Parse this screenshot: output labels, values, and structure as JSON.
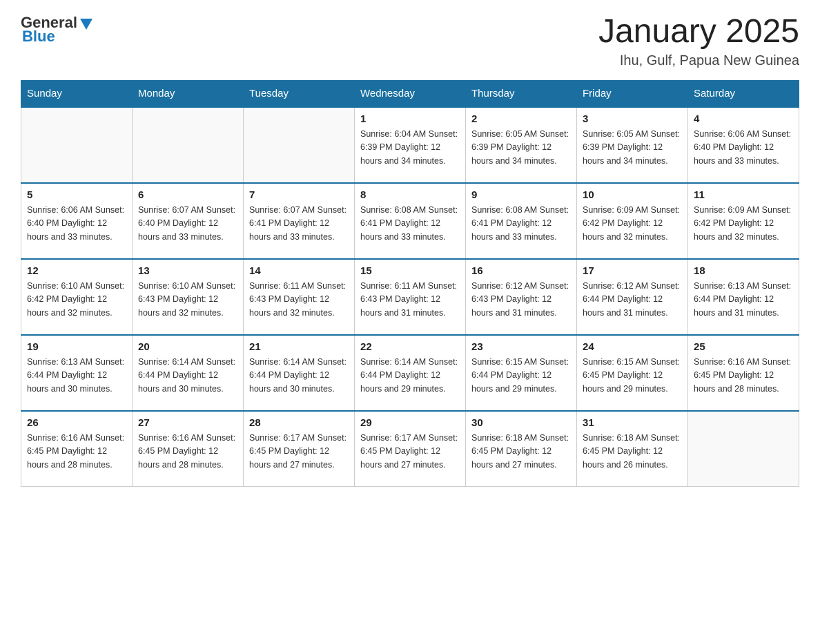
{
  "header": {
    "logo_general": "General",
    "logo_blue": "Blue",
    "month_title": "January 2025",
    "location": "Ihu, Gulf, Papua New Guinea"
  },
  "days_of_week": [
    "Sunday",
    "Monday",
    "Tuesday",
    "Wednesday",
    "Thursday",
    "Friday",
    "Saturday"
  ],
  "weeks": [
    [
      {
        "day": "",
        "info": ""
      },
      {
        "day": "",
        "info": ""
      },
      {
        "day": "",
        "info": ""
      },
      {
        "day": "1",
        "info": "Sunrise: 6:04 AM\nSunset: 6:39 PM\nDaylight: 12 hours\nand 34 minutes."
      },
      {
        "day": "2",
        "info": "Sunrise: 6:05 AM\nSunset: 6:39 PM\nDaylight: 12 hours\nand 34 minutes."
      },
      {
        "day": "3",
        "info": "Sunrise: 6:05 AM\nSunset: 6:39 PM\nDaylight: 12 hours\nand 34 minutes."
      },
      {
        "day": "4",
        "info": "Sunrise: 6:06 AM\nSunset: 6:40 PM\nDaylight: 12 hours\nand 33 minutes."
      }
    ],
    [
      {
        "day": "5",
        "info": "Sunrise: 6:06 AM\nSunset: 6:40 PM\nDaylight: 12 hours\nand 33 minutes."
      },
      {
        "day": "6",
        "info": "Sunrise: 6:07 AM\nSunset: 6:40 PM\nDaylight: 12 hours\nand 33 minutes."
      },
      {
        "day": "7",
        "info": "Sunrise: 6:07 AM\nSunset: 6:41 PM\nDaylight: 12 hours\nand 33 minutes."
      },
      {
        "day": "8",
        "info": "Sunrise: 6:08 AM\nSunset: 6:41 PM\nDaylight: 12 hours\nand 33 minutes."
      },
      {
        "day": "9",
        "info": "Sunrise: 6:08 AM\nSunset: 6:41 PM\nDaylight: 12 hours\nand 33 minutes."
      },
      {
        "day": "10",
        "info": "Sunrise: 6:09 AM\nSunset: 6:42 PM\nDaylight: 12 hours\nand 32 minutes."
      },
      {
        "day": "11",
        "info": "Sunrise: 6:09 AM\nSunset: 6:42 PM\nDaylight: 12 hours\nand 32 minutes."
      }
    ],
    [
      {
        "day": "12",
        "info": "Sunrise: 6:10 AM\nSunset: 6:42 PM\nDaylight: 12 hours\nand 32 minutes."
      },
      {
        "day": "13",
        "info": "Sunrise: 6:10 AM\nSunset: 6:43 PM\nDaylight: 12 hours\nand 32 minutes."
      },
      {
        "day": "14",
        "info": "Sunrise: 6:11 AM\nSunset: 6:43 PM\nDaylight: 12 hours\nand 32 minutes."
      },
      {
        "day": "15",
        "info": "Sunrise: 6:11 AM\nSunset: 6:43 PM\nDaylight: 12 hours\nand 31 minutes."
      },
      {
        "day": "16",
        "info": "Sunrise: 6:12 AM\nSunset: 6:43 PM\nDaylight: 12 hours\nand 31 minutes."
      },
      {
        "day": "17",
        "info": "Sunrise: 6:12 AM\nSunset: 6:44 PM\nDaylight: 12 hours\nand 31 minutes."
      },
      {
        "day": "18",
        "info": "Sunrise: 6:13 AM\nSunset: 6:44 PM\nDaylight: 12 hours\nand 31 minutes."
      }
    ],
    [
      {
        "day": "19",
        "info": "Sunrise: 6:13 AM\nSunset: 6:44 PM\nDaylight: 12 hours\nand 30 minutes."
      },
      {
        "day": "20",
        "info": "Sunrise: 6:14 AM\nSunset: 6:44 PM\nDaylight: 12 hours\nand 30 minutes."
      },
      {
        "day": "21",
        "info": "Sunrise: 6:14 AM\nSunset: 6:44 PM\nDaylight: 12 hours\nand 30 minutes."
      },
      {
        "day": "22",
        "info": "Sunrise: 6:14 AM\nSunset: 6:44 PM\nDaylight: 12 hours\nand 29 minutes."
      },
      {
        "day": "23",
        "info": "Sunrise: 6:15 AM\nSunset: 6:44 PM\nDaylight: 12 hours\nand 29 minutes."
      },
      {
        "day": "24",
        "info": "Sunrise: 6:15 AM\nSunset: 6:45 PM\nDaylight: 12 hours\nand 29 minutes."
      },
      {
        "day": "25",
        "info": "Sunrise: 6:16 AM\nSunset: 6:45 PM\nDaylight: 12 hours\nand 28 minutes."
      }
    ],
    [
      {
        "day": "26",
        "info": "Sunrise: 6:16 AM\nSunset: 6:45 PM\nDaylight: 12 hours\nand 28 minutes."
      },
      {
        "day": "27",
        "info": "Sunrise: 6:16 AM\nSunset: 6:45 PM\nDaylight: 12 hours\nand 28 minutes."
      },
      {
        "day": "28",
        "info": "Sunrise: 6:17 AM\nSunset: 6:45 PM\nDaylight: 12 hours\nand 27 minutes."
      },
      {
        "day": "29",
        "info": "Sunrise: 6:17 AM\nSunset: 6:45 PM\nDaylight: 12 hours\nand 27 minutes."
      },
      {
        "day": "30",
        "info": "Sunrise: 6:18 AM\nSunset: 6:45 PM\nDaylight: 12 hours\nand 27 minutes."
      },
      {
        "day": "31",
        "info": "Sunrise: 6:18 AM\nSunset: 6:45 PM\nDaylight: 12 hours\nand 26 minutes."
      },
      {
        "day": "",
        "info": ""
      }
    ]
  ]
}
